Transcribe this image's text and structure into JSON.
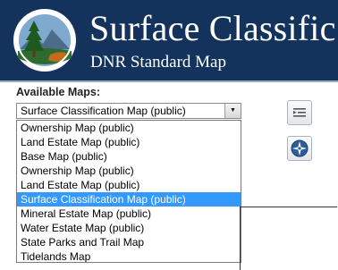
{
  "header": {
    "title": "Surface Classific",
    "subtitle": "DNR Standard Map",
    "logo_icon": "dnr-seal-logo",
    "background_color": "#14335c"
  },
  "panel": {
    "available_maps_label": "Available Maps:",
    "selected_value": "Surface Classification Map (public)",
    "options": [
      "Ownership Map (public)",
      "Land Estate Map (public)",
      "Base Map (public)",
      "Ownership Map (public)",
      "Land Estate Map (public)",
      "Surface Classification Map (public)",
      "Mineral Estate Map (public)",
      "Water Estate Map (public)",
      "State Parks and Trail Map",
      "Tidelands Map"
    ],
    "highlighted_index": 5,
    "highlight_color": "#3399ff"
  },
  "side_buttons": [
    {
      "icon": "list-indent-icon"
    },
    {
      "icon": "compass-icon"
    }
  ]
}
